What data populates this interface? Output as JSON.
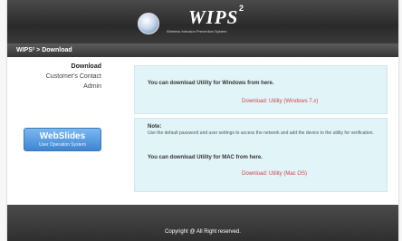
{
  "header": {
    "logo_text": "WIPS",
    "logo_superscript": "2",
    "logo_subtitle": "Wireless Intrusion Prevention System"
  },
  "breadcrumb": "WIPS² > Download",
  "nav": {
    "items": [
      {
        "label": "Download",
        "active": true
      },
      {
        "label": "Customer's Contact",
        "active": false
      },
      {
        "label": "Admin",
        "active": false
      }
    ]
  },
  "main": {
    "windows_text": "You can download Utility for Windows from here.",
    "windows_link": "Download: Utility (Windows 7.x)",
    "note_label": "Note:",
    "note_text": "Use the default password and user settings to access the network and add the device to the utility for verification.",
    "mac_text": "You can download Utility for MAC from here.",
    "mac_link": "Download: Utility (Mac OS)"
  },
  "webslides": {
    "title": "WebSlides",
    "subtitle": "User Operation System"
  },
  "footer": {
    "text": "Copyright @ All Right reserved."
  }
}
